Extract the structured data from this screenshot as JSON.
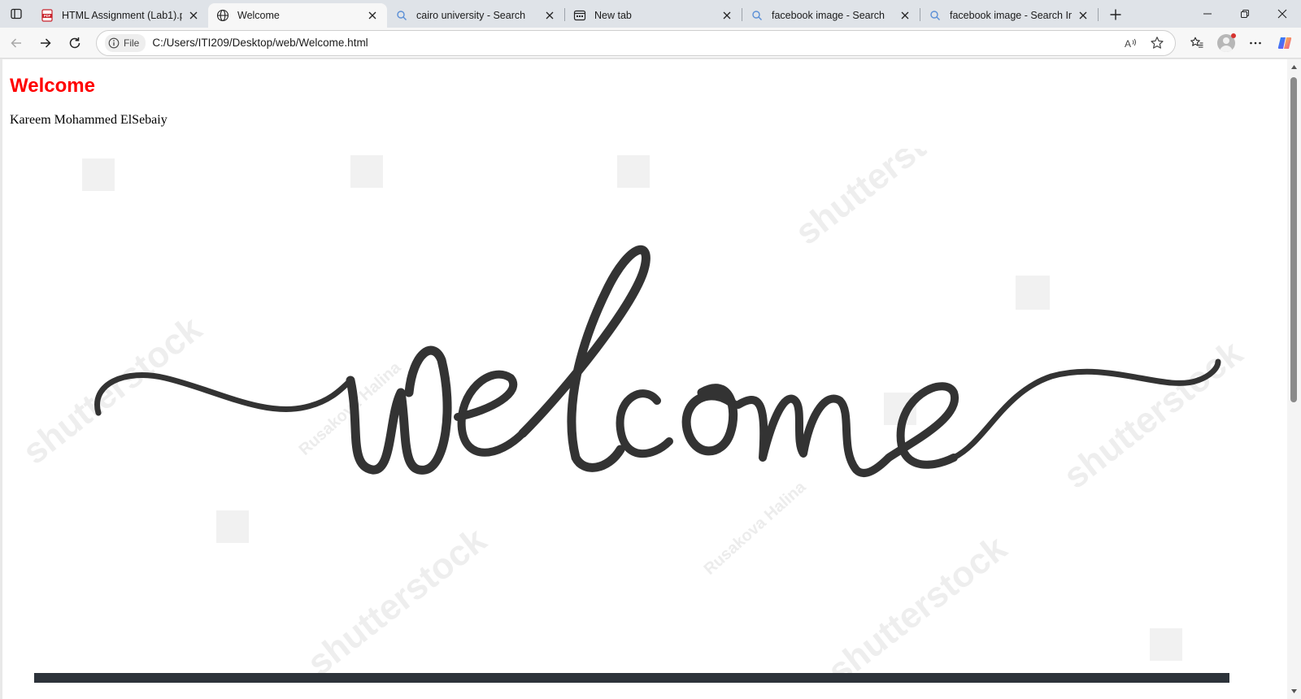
{
  "browser": {
    "tabs": [
      {
        "title": "HTML Assignment (Lab1).pdf",
        "icon": "pdf-icon",
        "active": false
      },
      {
        "title": "Welcome",
        "icon": "globe-icon",
        "active": true
      },
      {
        "title": "cairo university - Search",
        "icon": "search-icon",
        "active": false
      },
      {
        "title": "New tab",
        "icon": "newtab-icon",
        "active": false
      },
      {
        "title": "facebook image - Search",
        "icon": "search-icon",
        "active": false
      },
      {
        "title": "facebook image - Search Imag",
        "icon": "search-icon",
        "active": false
      }
    ],
    "address": {
      "chip_label": "File",
      "url": "C:/Users/ITI209/Desktop/web/Welcome.html"
    }
  },
  "page": {
    "heading": "Welcome",
    "name": "Kareem Mohammed ElSebaiy",
    "image": {
      "script_text": "welcome",
      "watermark": "shutterstock",
      "watermark_author": "Rusakova Halina"
    }
  },
  "colors": {
    "heading": "#ff0000",
    "script_ink": "#333333",
    "bottom_bar": "#2d333a"
  }
}
